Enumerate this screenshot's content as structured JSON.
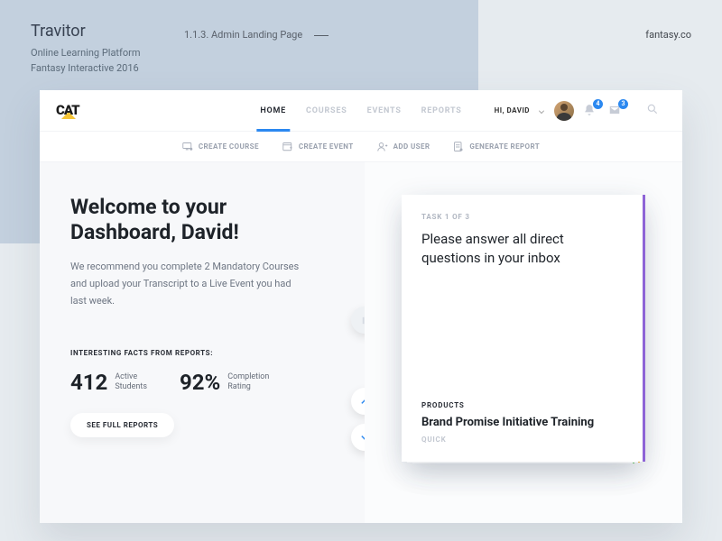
{
  "page": {
    "brand": "Travitor",
    "subtitle1": "Online Learning Platform",
    "subtitle2": "Fantasy Interactive 2016",
    "crumb": "1.1.3. Admin Landing Page",
    "credit": "fantasy.co"
  },
  "logo": {
    "text": "CAT"
  },
  "nav": [
    "HOME",
    "COURSES",
    "EVENTS",
    "REPORTS"
  ],
  "nav_active_index": 0,
  "user": {
    "greeting": "HI, DAVID"
  },
  "badges": {
    "notifications": "4",
    "inbox": "3"
  },
  "quick_actions": [
    "CREATE COURSE",
    "CREATE EVENT",
    "ADD USER",
    "GENERATE REPORT"
  ],
  "welcome": {
    "title_line1": "Welcome to your",
    "title_line2": "Dashboard, David!",
    "desc": "We recommend you complete 2 Mandatory Courses and upload your Transcript to a Live Event you had last week."
  },
  "facts": {
    "label": "INTERESTING FACTS FROM REPORTS:",
    "stat1_num": "412",
    "stat1_label1": "Active",
    "stat1_label2": "Students",
    "stat2_num": "92%",
    "stat2_label1": "Completion",
    "stat2_label2": "Rating",
    "button": "SEE FULL REPORTS"
  },
  "task": {
    "count": "TASK 1 OF 3",
    "title": "Please answer all direct questions in your inbox",
    "section_label": "PRODUCTS",
    "item_title": "Brand Promise Initiative Training",
    "item_sub": "QUICK"
  },
  "colors": {
    "accent_blue": "#2b88f0",
    "accent_purple": "#8e64d6",
    "accent_yellow": "#f0b043",
    "accent_green": "#77c972"
  }
}
